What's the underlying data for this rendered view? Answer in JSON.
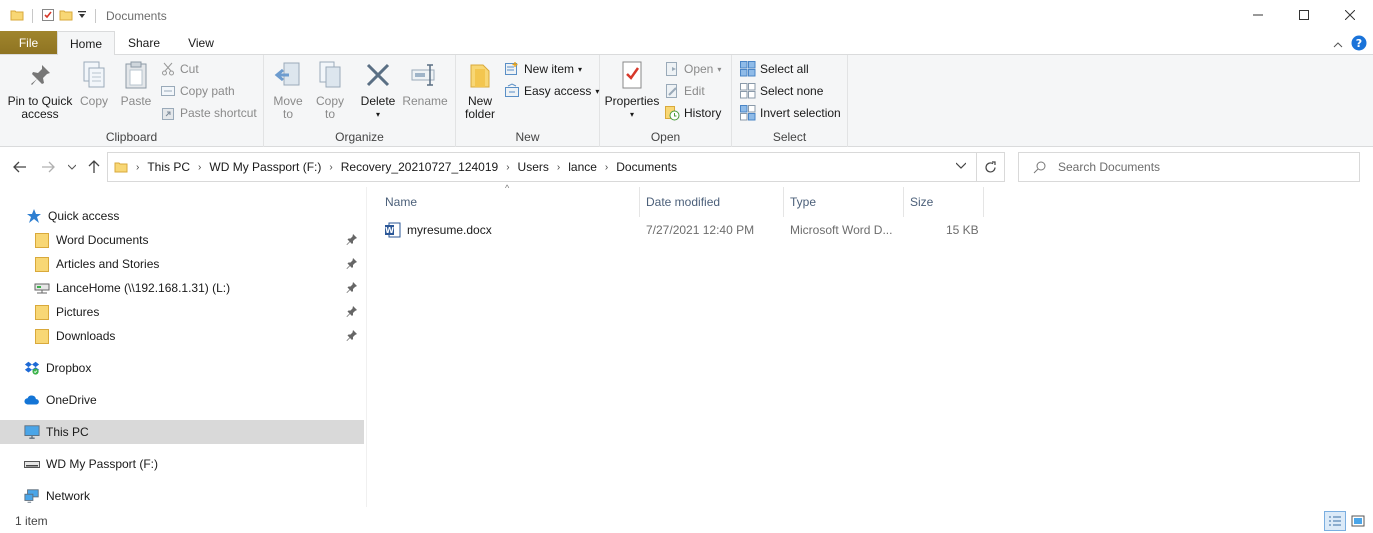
{
  "window": {
    "title": "Documents",
    "controls": [
      "minimize-icon",
      "maximize-icon",
      "close-icon"
    ]
  },
  "ribbon_tabs": [
    {
      "label": "File",
      "active": false
    },
    {
      "label": "Home",
      "active": true
    },
    {
      "label": "Share",
      "active": false
    },
    {
      "label": "View",
      "active": false
    }
  ],
  "ribbon": {
    "clipboard": {
      "label": "Clipboard",
      "pin": "Pin to Quick access",
      "pin_l1": "Pin to Quick",
      "pin_l2": "access",
      "copy": "Copy",
      "paste": "Paste",
      "cut": "Cut",
      "copy_path": "Copy path",
      "paste_shortcut": "Paste shortcut"
    },
    "organize": {
      "label": "Organize",
      "move_to": "Move",
      "move_to_2": "to",
      "copy_to": "Copy",
      "copy_to_2": "to",
      "delete": "Delete",
      "rename": "Rename"
    },
    "new": {
      "label": "New",
      "new_folder_1": "New",
      "new_folder_2": "folder",
      "new_item": "New item",
      "easy_access": "Easy access"
    },
    "open": {
      "label": "Open",
      "properties": "Properties",
      "open": "Open",
      "edit": "Edit",
      "history": "History"
    },
    "select": {
      "label": "Select",
      "select_all": "Select all",
      "select_none": "Select none",
      "invert_selection": "Invert selection"
    }
  },
  "address": {
    "crumbs": [
      "This PC",
      "WD My Passport (F:)",
      "Recovery_20210727_124019",
      "Users",
      "lance",
      "Documents"
    ],
    "search_placeholder": "Search Documents"
  },
  "nav": {
    "quick_access": "Quick access",
    "pinned": [
      {
        "label": "Word Documents",
        "icon": "folder-icon"
      },
      {
        "label": "Articles and Stories",
        "icon": "folder-icon"
      },
      {
        "label": "LanceHome (\\\\192.168.1.31) (L:)",
        "icon": "network-drive-icon"
      },
      {
        "label": "Pictures",
        "icon": "folder-icon"
      },
      {
        "label": "Downloads",
        "icon": "folder-icon"
      }
    ],
    "dropbox": "Dropbox",
    "onedrive": "OneDrive",
    "this_pc": "This PC",
    "wd_passport": "WD My Passport (F:)",
    "network": "Network"
  },
  "files": {
    "columns": {
      "name": "Name",
      "date": "Date modified",
      "type": "Type",
      "size": "Size"
    },
    "rows": [
      {
        "name": "myresume.docx",
        "date": "7/27/2021 12:40 PM",
        "type": "Microsoft Word D...",
        "size": "15 KB",
        "icon": "word-doc-icon"
      }
    ]
  },
  "status": {
    "count": "1 item"
  },
  "colors": {
    "file_tab": "#9c7f24",
    "ribbon_bg": "#f5f6f7",
    "selected_nav": "#d9d9d9",
    "column_header": "#4c607a",
    "help_blue": "#1a73d9"
  }
}
